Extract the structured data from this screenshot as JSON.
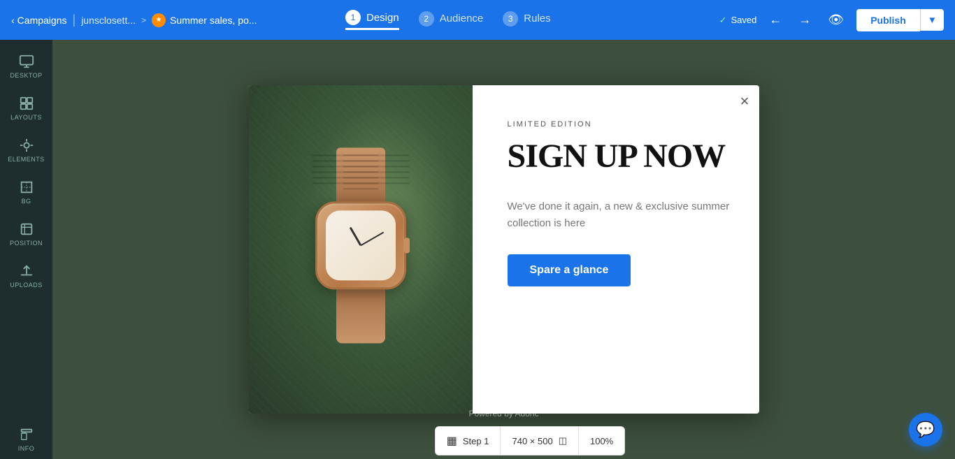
{
  "topnav": {
    "back_label": "Campaigns",
    "breadcrumb1": "junsclosett...",
    "current_name": "Summer sales, po...",
    "saved_label": "Saved",
    "publish_label": "Publish",
    "steps": [
      {
        "num": "1",
        "label": "Design",
        "active": true
      },
      {
        "num": "2",
        "label": "Audience",
        "active": false
      },
      {
        "num": "3",
        "label": "Rules",
        "active": false
      }
    ]
  },
  "sidebar": {
    "items": [
      {
        "id": "desktop",
        "label": "DESKTOP",
        "icon": "desktop"
      },
      {
        "id": "layouts",
        "label": "LAYOUTS",
        "icon": "layouts"
      },
      {
        "id": "elements",
        "label": "ELEMENTS",
        "icon": "elements"
      },
      {
        "id": "bg",
        "label": "BG",
        "icon": "bg"
      },
      {
        "id": "position",
        "label": "POSITION",
        "icon": "position"
      },
      {
        "id": "uploads",
        "label": "UPLOADS",
        "icon": "uploads"
      },
      {
        "id": "info",
        "label": "INFO",
        "icon": "info"
      }
    ]
  },
  "popup": {
    "close_label": "×",
    "subtitle": "LIMITED EDITION",
    "title": "SIGN UP NOW",
    "description": "We've done it again, a new & exclusive summer collection is here",
    "cta_label": "Spare a glance"
  },
  "bottom_bar": {
    "powered_label": "Powered by Adoric",
    "step_label": "Step 1",
    "size_label": "740 × 500",
    "zoom_label": "100%"
  }
}
